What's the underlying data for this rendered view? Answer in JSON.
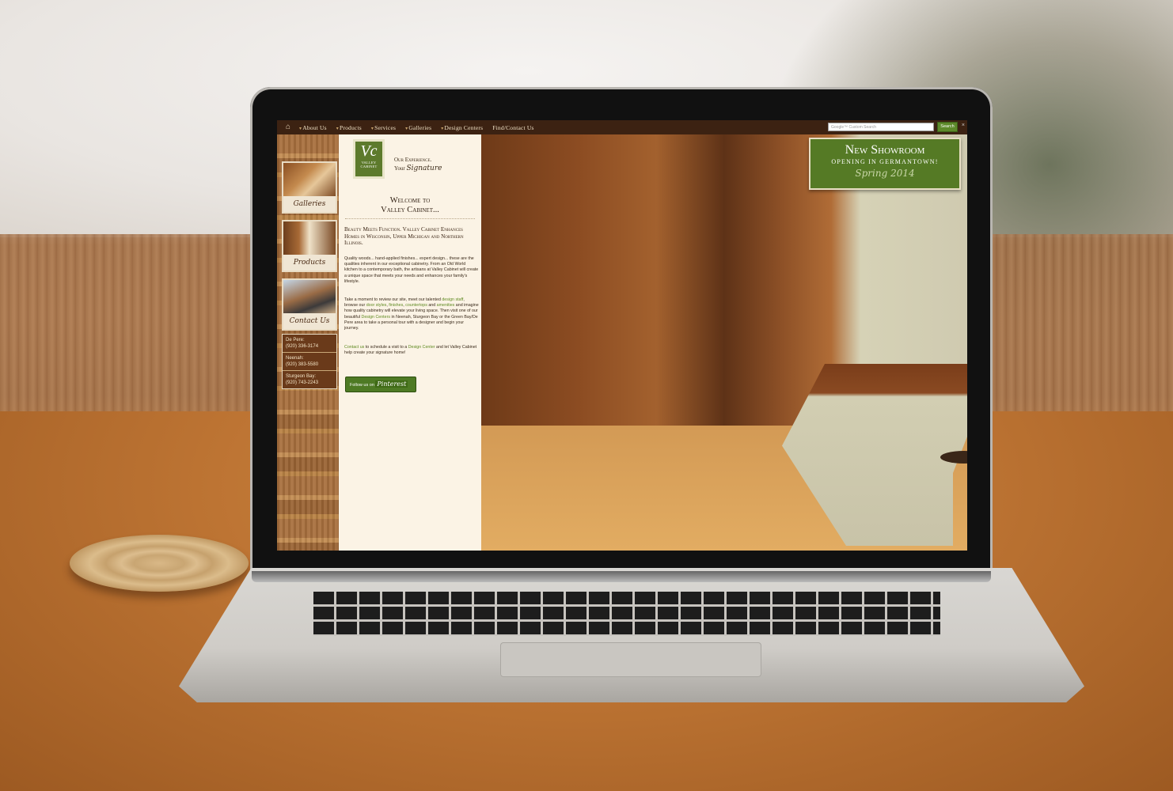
{
  "nav": {
    "items": [
      "About Us",
      "Products",
      "Services",
      "Galleries",
      "Design Centers",
      "Find/Contact Us"
    ],
    "search_placeholder": "Google™ Custom Search",
    "search_button": "Search",
    "close_glyph": "×"
  },
  "sidebar": {
    "tiles": [
      "Galleries",
      "Products",
      "Contact Us"
    ],
    "locations": [
      {
        "name": "De Pere:",
        "phone": "(920) 336-3174"
      },
      {
        "name": "Neenah:",
        "phone": "(920) 383-5580"
      },
      {
        "name": "Sturgeon Bay:",
        "phone": "(920) 743-2243"
      }
    ]
  },
  "content": {
    "logo_mark": "Vc",
    "logo_line1": "VALLEY",
    "logo_line2": "CABINET",
    "tagline_1": "Our Experience.",
    "tagline_2a": "Your",
    "tagline_2b": "Signature",
    "welcome_1": "Welcome to",
    "welcome_2": "Valley Cabinet...",
    "lead": "Beauty Meets Function. Valley Cabinet Enhances Homes in Wisconsin, Upper Michigan and Northern Illinois.",
    "p1": "Quality woods... hand-applied finishes... expert design... these are the qualities inherent in our exceptional cabinetry. From an Old World kitchen to a contemporary bath, the artisans at Valley Cabinet will create a unique space that meets your needs and enhances your family's lifestyle.",
    "p2_a": "Take a moment to review our site, meet our talented ",
    "p2_link1": "design staff",
    "p2_b": ", browse our ",
    "p2_link2": "door styles",
    "p2_c": ", ",
    "p2_link3": "finishes",
    "p2_d": ", ",
    "p2_link4": "countertops",
    "p2_e": " and ",
    "p2_link5": "amenities",
    "p2_f": " and imagine how quality cabinetry will elevate your living space. Then visit one of our beautiful ",
    "p2_link6": "Design Centers",
    "p2_g": " in Neenah, Sturgeon Bay or the Green Bay/De Pere area to take a personal tour with a designer and begin your journey.",
    "p3_link1": "Contact us",
    "p3_a": " to schedule a visit to a ",
    "p3_link2": "Design Center",
    "p3_b": " and let Valley Cabinet help create your signature home!",
    "pinterest_prefix": "Follow us on",
    "pinterest_brand": "Pinterest"
  },
  "banner": {
    "line1": "New Showroom",
    "line2": "OPENING IN GERMANTOWN!",
    "line3": "Spring 2014"
  }
}
